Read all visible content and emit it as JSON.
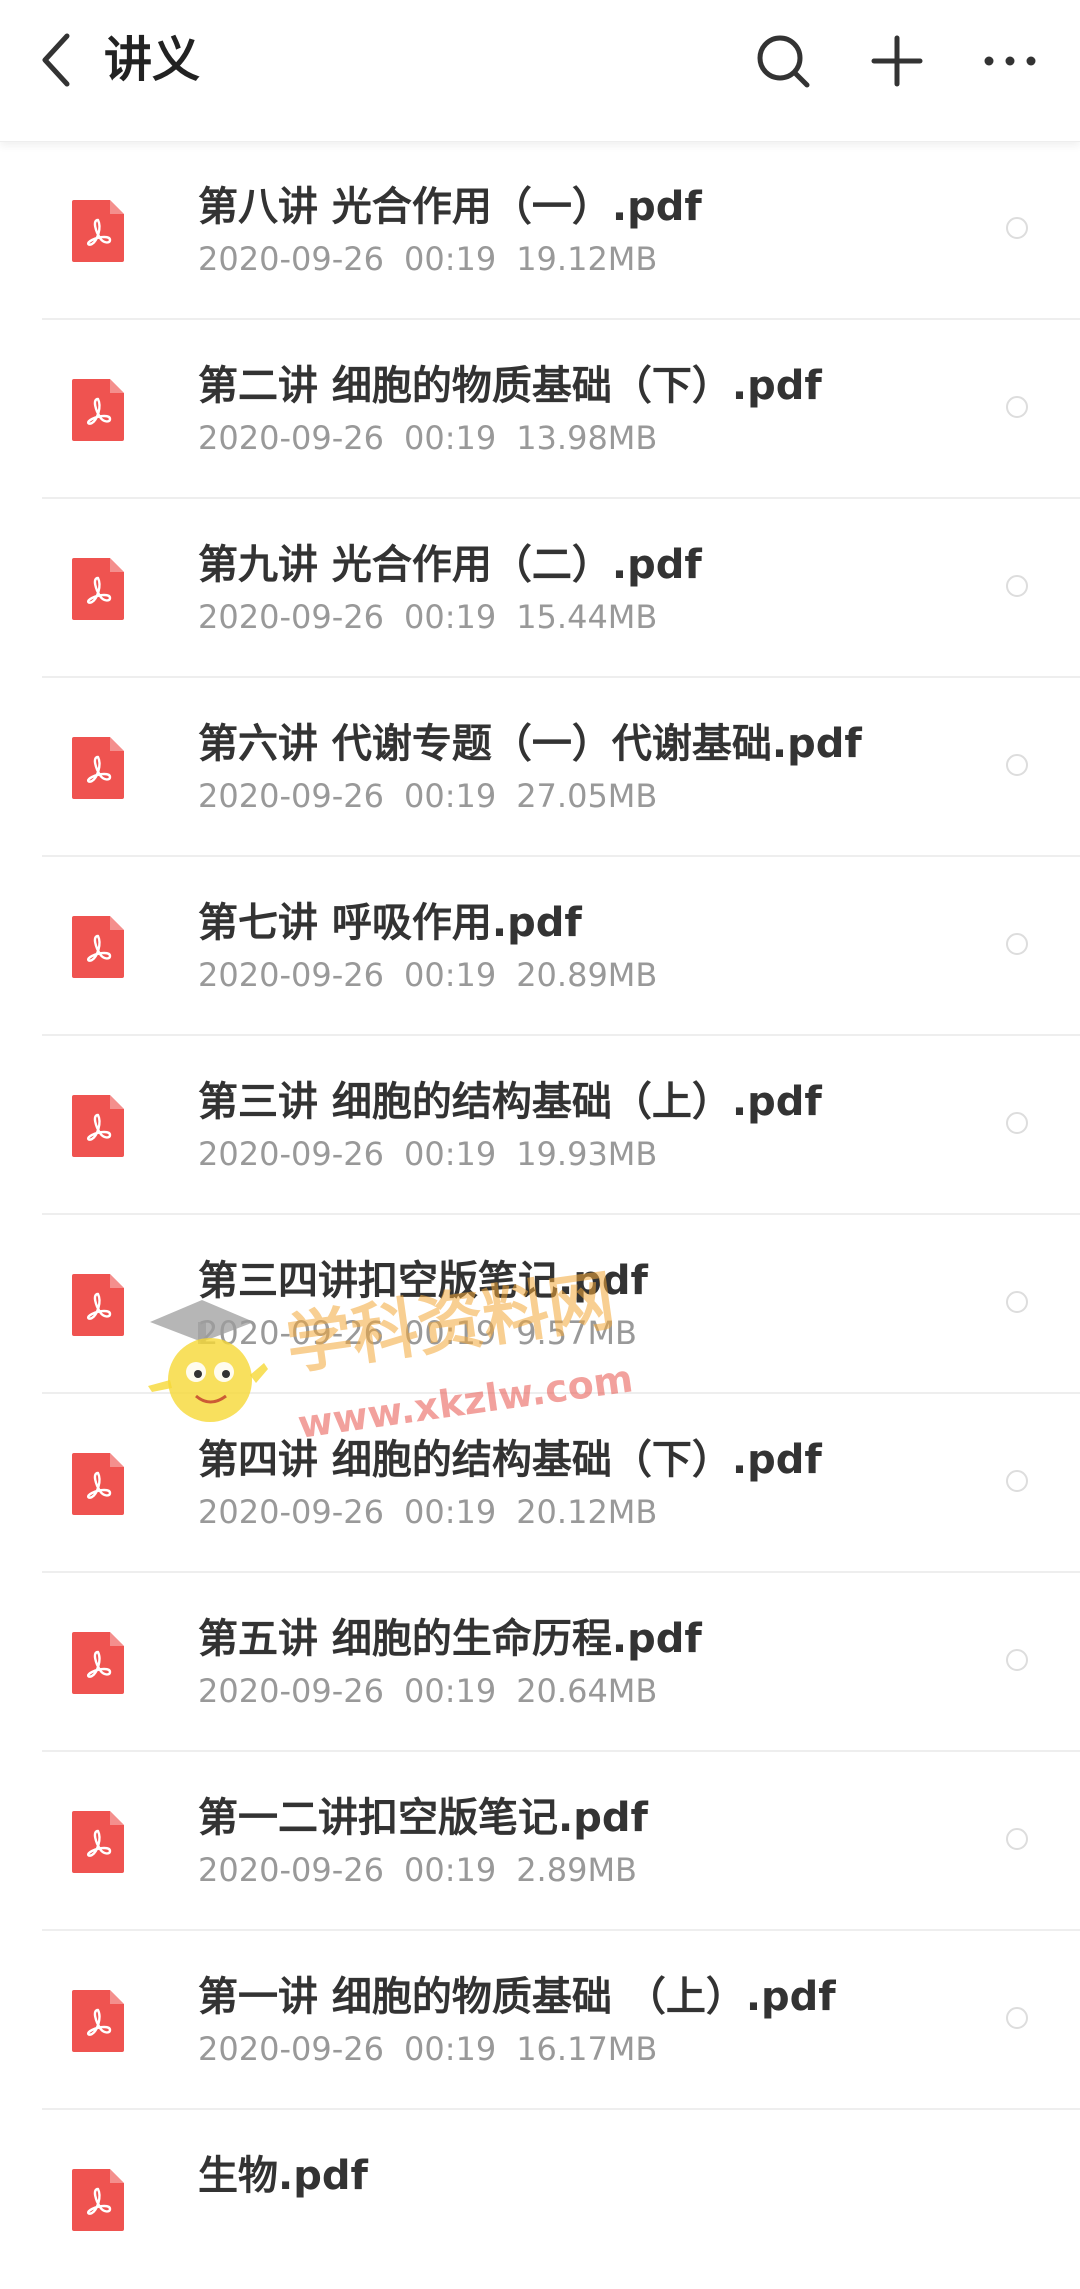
{
  "header": {
    "title": "讲义",
    "icons": [
      "back-arrow-icon",
      "search-icon",
      "plus-icon",
      "more-icon"
    ]
  },
  "files": [
    {
      "name": "第八讲 光合作用（一）.pdf",
      "date": "2020-09-26",
      "time": "00:19",
      "size": "19.12MB"
    },
    {
      "name": "第二讲 细胞的物质基础（下）.pdf",
      "date": "2020-09-26",
      "time": "00:19",
      "size": "13.98MB"
    },
    {
      "name": "第九讲 光合作用（二）.pdf",
      "date": "2020-09-26",
      "time": "00:19",
      "size": "15.44MB"
    },
    {
      "name": "第六讲 代谢专题（一）代谢基础.pdf",
      "date": "2020-09-26",
      "time": "00:19",
      "size": "27.05MB"
    },
    {
      "name": "第七讲 呼吸作用.pdf",
      "date": "2020-09-26",
      "time": "00:19",
      "size": "20.89MB"
    },
    {
      "name": "第三讲 细胞的结构基础（上）.pdf",
      "date": "2020-09-26",
      "time": "00:19",
      "size": "19.93MB"
    },
    {
      "name": "第三四讲扣空版笔记.pdf",
      "date": "2020-09-26",
      "time": "00:19",
      "size": "9.57MB"
    },
    {
      "name": "第四讲 细胞的结构基础（下）.pdf",
      "date": "2020-09-26",
      "time": "00:19",
      "size": "20.12MB"
    },
    {
      "name": "第五讲 细胞的生命历程.pdf",
      "date": "2020-09-26",
      "time": "00:19",
      "size": "20.64MB"
    },
    {
      "name": "第一二讲扣空版笔记.pdf",
      "date": "2020-09-26",
      "time": "00:19",
      "size": "2.89MB"
    },
    {
      "name": "第一讲 细胞的物质基础 （上）.pdf",
      "date": "2020-09-26",
      "time": "00:19",
      "size": "16.17MB"
    },
    {
      "name": "生物.pdf",
      "date": "",
      "time": "",
      "size": ""
    }
  ],
  "watermark": {
    "title": "学科资料网",
    "url": "www.xkzlw.com"
  },
  "colors": {
    "pdf_icon": "#ef5350",
    "text_primary": "#333333",
    "text_secondary": "#999999",
    "divider": "#eeeeee"
  }
}
